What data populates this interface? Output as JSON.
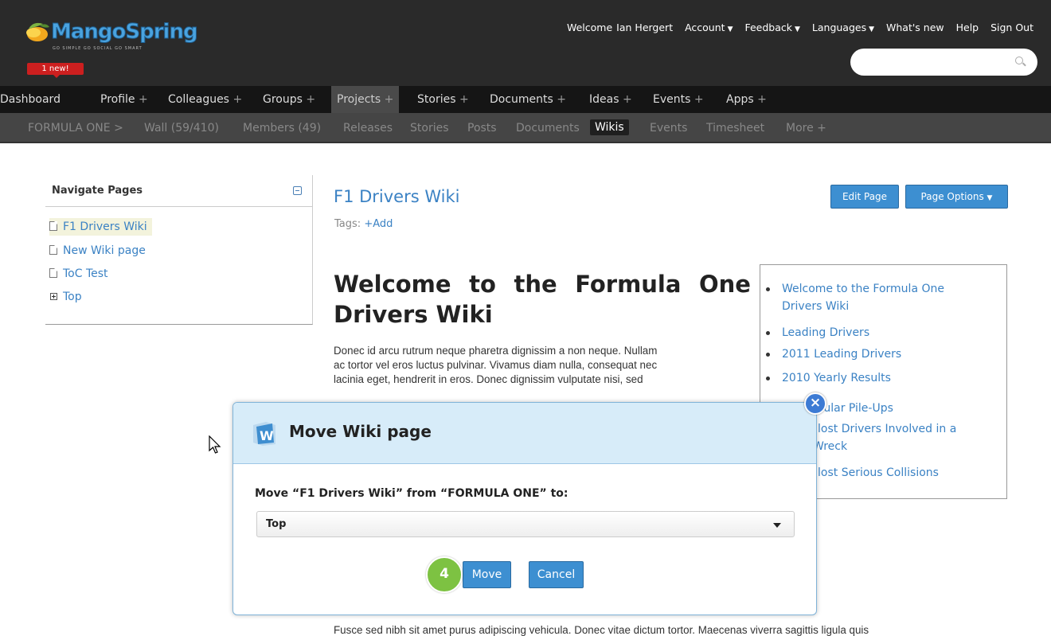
{
  "header": {
    "brand": "MangoSpring",
    "tagline": "GO SIMPLE  GO SOCIAL  GO SMART",
    "new_badge": "1 new!",
    "welcome": "Welcome",
    "user": "Ian Hergert",
    "links": [
      "Account",
      "Feedback",
      "Languages",
      "What's new",
      "Help",
      "Sign Out"
    ],
    "search_placeholder": ""
  },
  "mainnav": [
    {
      "label": "Dashboard",
      "plus": ""
    },
    {
      "label": "Profile",
      "plus": "+"
    },
    {
      "label": "Colleagues",
      "plus": "+"
    },
    {
      "label": "Groups",
      "plus": "+"
    },
    {
      "label": "Projects",
      "plus": "+"
    },
    {
      "label": "Stories",
      "plus": "+"
    },
    {
      "label": "Documents",
      "plus": "+"
    },
    {
      "label": "Ideas",
      "plus": "+"
    },
    {
      "label": "Events",
      "plus": "+"
    },
    {
      "label": "Apps",
      "plus": "+"
    }
  ],
  "subnav": {
    "project": "FORMULA ONE",
    "sep": ">",
    "items": [
      "Wall (59/410)",
      "Members (49)",
      "Releases",
      "Stories",
      "Posts",
      "Documents",
      "Wikis",
      "Events",
      "Timesheet",
      "More +"
    ]
  },
  "sidebar": {
    "title": "Navigate Pages",
    "pages": [
      "F1 Drivers Wiki",
      "New Wiki page",
      "ToC Test",
      "Top"
    ]
  },
  "page": {
    "title": "F1 Drivers Wiki",
    "tags_label": "Tags:",
    "tags_add": "+Add",
    "edit_button": "Edit Page",
    "options_button": "Page Options",
    "heading_line1": [
      "Welcome",
      "to",
      "the",
      "Formula",
      "One"
    ],
    "heading_line2": "Drivers Wiki",
    "para_lines": [
      "Donec id arcu rutrum neque pharetra dignissim a non neque. Nullam",
      "ac tortor vel eros luctus pulvinar. Vivamus diam nulla, consequat nec",
      "lacinia eget, hendrerit in eros. Donec dignissim vulputate nisi, sed"
    ],
    "para2": "Fusce sed nibh sit amet purus adipiscing vehicula. Donec vitae dictum tortor. Maecenas viverra sagittis ligula quis"
  },
  "toc": [
    "Welcome to the Formula One",
    "Drivers Wiki",
    "Leading Drivers",
    "2011 Leading Drivers",
    "2010 Yearly Results",
    "zular Pile-Ups",
    "lost Drivers Involved in a",
    "Wreck",
    "lost Serious Collisions"
  ],
  "modal": {
    "title": "Move Wiki page",
    "label": "Move “F1 Drivers Wiki” from “FORMULA ONE” to:",
    "selected": "Top",
    "move_button": "Move",
    "cancel_button": "Cancel",
    "close": "×",
    "step_number": "4"
  },
  "colors": {
    "header_bg": "#2a2a2a",
    "link": "#3b82c4",
    "button": "#3d8fd1",
    "modal_head": "#d7ecf9",
    "step_badge": "#7dc242",
    "new_badge": "#cc1f1f"
  }
}
